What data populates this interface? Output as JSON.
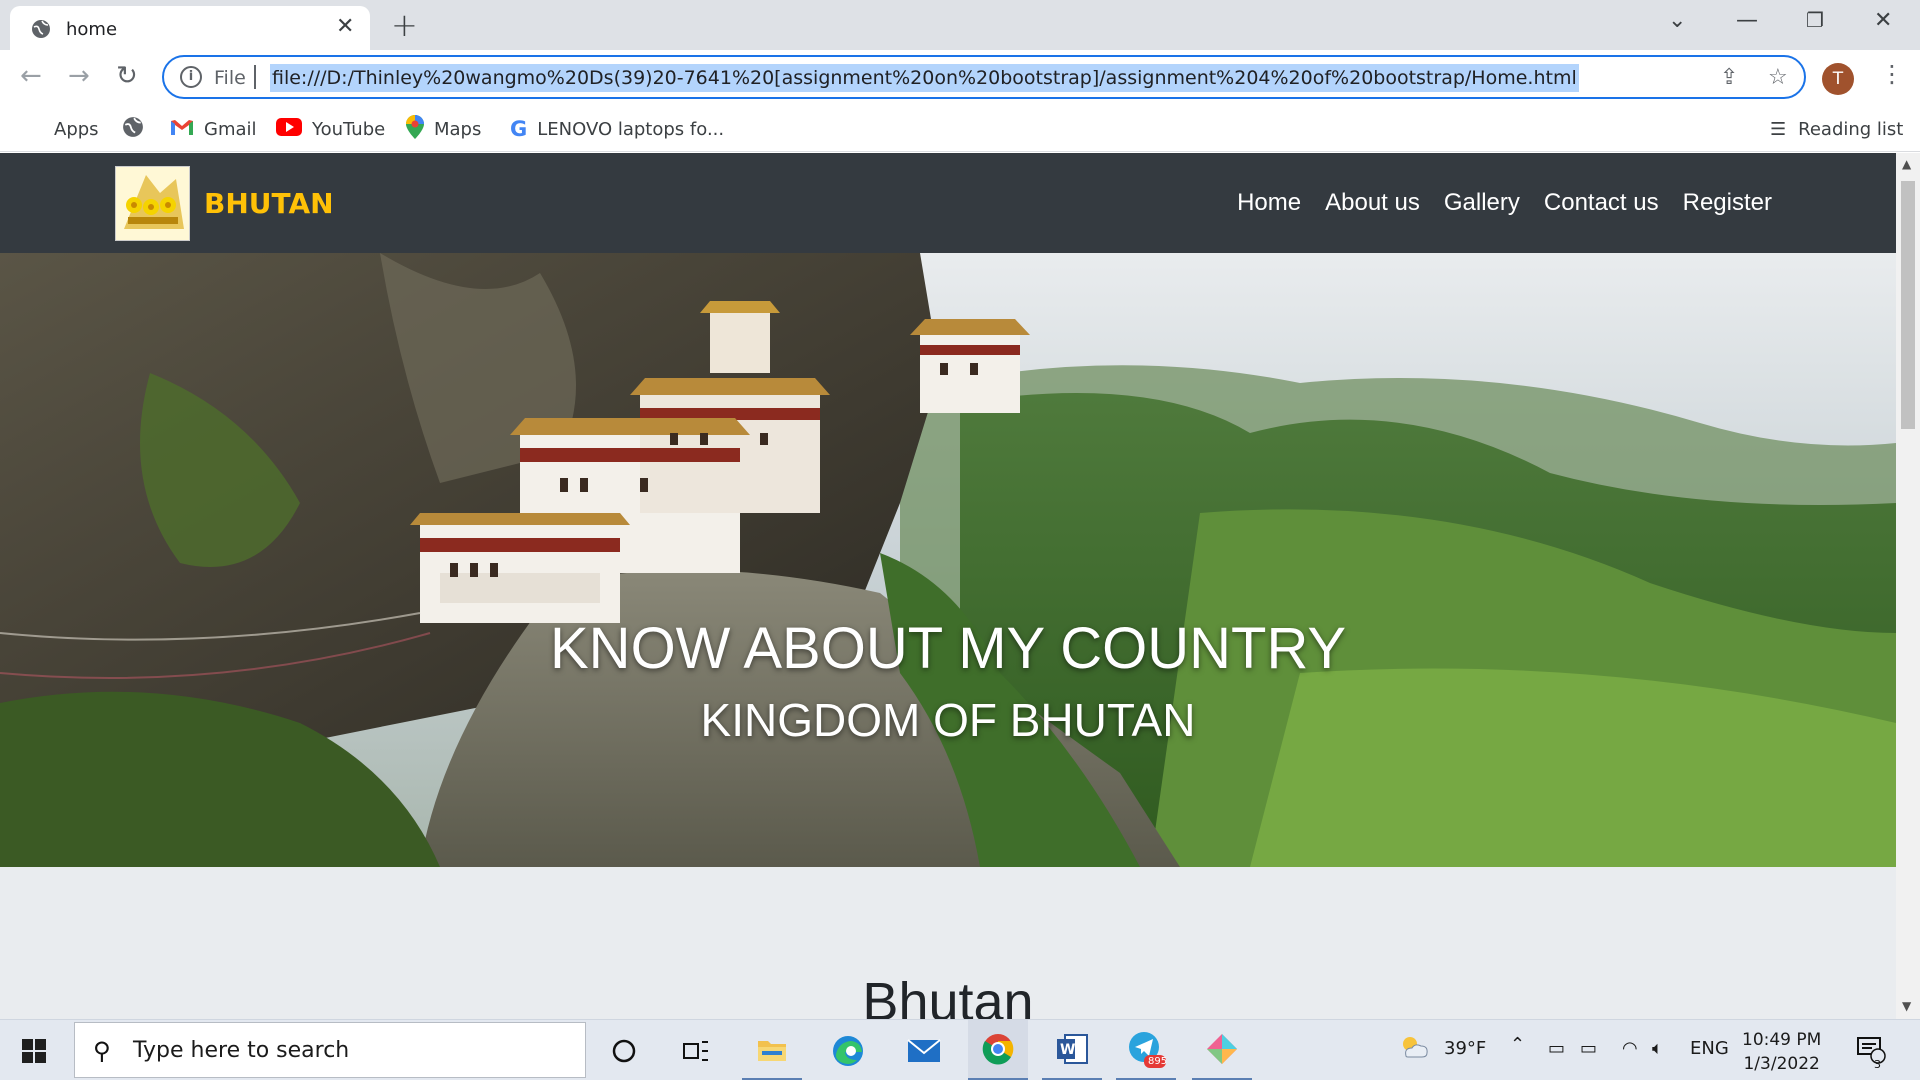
{
  "browser": {
    "tab_title": "home",
    "url_scheme": "File",
    "url": "file:///D:/Thinley%20wangmo%20Ds(39)20-7641%20[assignment%20on%20bootstrap]/assignment%204%20of%20bootstrap/Home.html",
    "profile_initial": "T",
    "bookmarks": {
      "apps": "Apps",
      "gmail": "Gmail",
      "youtube": "YouTube",
      "maps": "Maps",
      "lenovo": "LENOVO laptops fo..."
    },
    "reading_list": "Reading list"
  },
  "site": {
    "brand": "BHUTAN",
    "nav": [
      "Home",
      "About us",
      "Gallery",
      "Contact us",
      "Register"
    ],
    "hero_title": "KNOW ABOUT MY COUNTRY",
    "hero_subtitle": "KINGDOM OF BHUTAN",
    "section_heading": "Bhutan"
  },
  "taskbar": {
    "search_placeholder": "Type here to search",
    "weather": "39°F",
    "language": "ENG",
    "time": "10:49 PM",
    "date": "1/3/2022",
    "telegram_badge": "895",
    "notification_count": "3"
  },
  "colors": {
    "navbar_bg": "#343a40",
    "brand": "#ffc107",
    "omnibox_focus": "#1a73e8",
    "url_selection": "#b3d4fc"
  }
}
